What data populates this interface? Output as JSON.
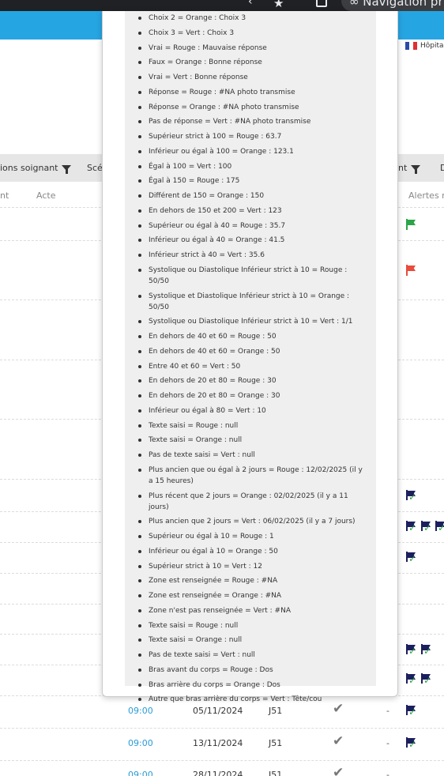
{
  "browser": {
    "private_label": "Navigation privée"
  },
  "header": {
    "language_label": "Hôpital"
  },
  "filters": [
    {
      "label": "ions soignant"
    },
    {
      "label": "Scé"
    },
    {
      "label": "nt"
    },
    {
      "label": "D"
    }
  ],
  "columns": [
    "nt",
    "Acte",
    "Alertes ré"
  ],
  "rows": [
    {
      "time": "09:00",
      "date": "05/11/2024",
      "code": "J51",
      "dash": "-"
    },
    {
      "time": "09:00",
      "date": "13/11/2024",
      "code": "J51",
      "dash": "-"
    },
    {
      "time": "09:00",
      "date": "28/11/2024",
      "code": "J51",
      "dash": "-"
    }
  ],
  "colors": {
    "header_blue": "#26a5e3",
    "flag_green": "#2ca449",
    "flag_red": "#e74c3c",
    "flag_navy": "#1c1f5e",
    "link_blue": "#2a9bd6"
  },
  "legend_items": [
    "Choix 2 = Orange : Choix 3",
    "Choix 3 = Vert : Choix 3",
    "Vrai = Rouge : Mauvaise réponse",
    "Faux = Orange : Bonne réponse",
    "Vrai = Vert : Bonne réponse",
    "Réponse = Rouge : #NA photo transmise",
    "Réponse = Orange : #NA photo transmise",
    "Pas de réponse = Vert : #NA photo transmise",
    "Supérieur strict à 100 = Rouge : 63.7",
    "Inférieur ou égal à 100 = Orange : 123.1",
    "Égal à 100 = Vert : 100",
    "Égal à 150 = Rouge : 175",
    "Différent de 150 = Orange : 150",
    "En dehors de 150 et 200 = Vert : 123",
    "Supérieur ou égal à 40 = Rouge : 35.7",
    "Inférieur ou égal à 40 = Orange : 41.5",
    "Inférieur strict à 40 = Vert : 35.6",
    "Systolique ou Diastolique Inférieur strict à 10 = Rouge : 50/50",
    "Systolique et Diastolique Inférieur strict à 10 = Orange : 50/50",
    "Systolique ou Diastolique Inférieur strict à 10 = Vert : 1/1",
    "En dehors de 40 et 60 = Rouge : 50",
    "En dehors de 40 et 60 = Orange : 50",
    "Entre 40 et 60 = Vert : 50",
    "En dehors de 20 et 80 = Rouge : 30",
    "En dehors de 20 et 80 = Orange : 30",
    "Inférieur ou égal à 80 = Vert : 10",
    "Texte saisi = Rouge : null",
    "Texte saisi = Orange : null",
    "Pas de texte saisi = Vert : null",
    "Plus ancien que ou égal à 2 jours = Rouge : 12/02/2025 (il y a 15 heures)",
    "Plus récent que 2 jours = Orange : 02/02/2025 (il y a 11 jours)",
    "Plus ancien que 2 jours = Vert : 06/02/2025 (il y a 7 jours)",
    "Supérieur ou égal à 10 = Rouge : 1",
    "Inférieur ou égal à 10 = Orange : 50",
    "Supérieur strict à 10 = Vert : 12",
    "Zone est renseignée = Rouge : #NA",
    "Zone est renseignée = Orange : #NA",
    "Zone n'est pas renseignée = Vert : #NA",
    "Texte saisi = Rouge : null",
    "Texte saisi = Orange : null",
    "Pas de texte saisi = Vert : null",
    "Bras avant du corps = Rouge : Dos",
    "Bras arrière du corps = Orange : Dos",
    "Autre que bras arrière du corps = Vert : Tête/cou"
  ]
}
